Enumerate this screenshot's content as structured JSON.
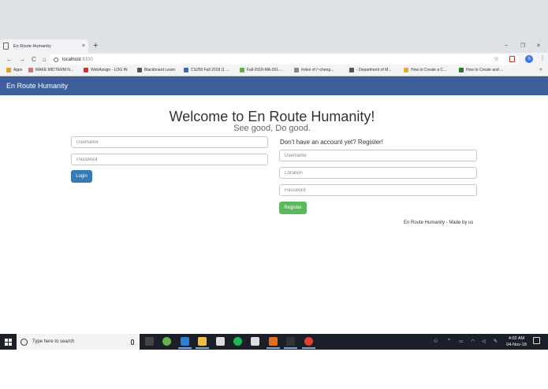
{
  "browser": {
    "tab": {
      "title": "En Route Humanity",
      "close": "×"
    },
    "new_tab": "+",
    "window": {
      "minimize": "–",
      "maximize": "❐",
      "close": "✕"
    },
    "nav": {
      "back": "←",
      "forward": "→",
      "reload": "C",
      "home": "⌂"
    },
    "url": {
      "host": "localhost",
      "port": ":8100"
    },
    "star": "☆",
    "profile_initial": "S",
    "menu": "⋮",
    "bookmarks": [
      {
        "label": "Apps",
        "color": "#e0a020"
      },
      {
        "label": "MAKE MIDTERM N...",
        "color": "#c77"
      },
      {
        "label": "WebAssign - LOG IN",
        "color": "#c33"
      },
      {
        "label": "Blackboard Learn",
        "color": "#555"
      },
      {
        "label": "CS250 Fall 2018 (1 ...",
        "color": "#3a6cb5"
      },
      {
        "label": "Fall-2018-MA-261-...",
        "color": "#6a4"
      },
      {
        "label": "Index of /~cheng...",
        "color": "#888"
      },
      {
        "label": "- Department of M...",
        "color": "#555"
      },
      {
        "label": "How to Create a C...",
        "color": "#e0b030"
      },
      {
        "label": "How to Create and ...",
        "color": "#2a7a2a"
      }
    ],
    "bookmarks_more": "»"
  },
  "app": {
    "brand": "En Route Humanity",
    "heading": "Welcome to En Route Humanity!",
    "subheading": "See good, Do good.",
    "login": {
      "username_placeholder": "Username",
      "password_placeholder": "Password",
      "button": "Login"
    },
    "register": {
      "heading": "Don't have an account yet? Register!",
      "username_placeholder": "Username",
      "location_placeholder": "Location",
      "password_placeholder": "Password",
      "button": "Register"
    },
    "footer": "En Route Humanity - Made by us"
  },
  "taskbar": {
    "search_placeholder": "Type here to search",
    "time": "4:02 AM",
    "date": "04-Nov-18",
    "apps": [
      {
        "name": "task-view",
        "color": "#444"
      },
      {
        "name": "android-studio",
        "color": "#6ab04c"
      },
      {
        "name": "edge",
        "color": "#2d7dd2"
      },
      {
        "name": "file-explorer",
        "color": "#f0c040"
      },
      {
        "name": "store",
        "color": "#ddd"
      },
      {
        "name": "spotify",
        "color": "#1db954"
      },
      {
        "name": "mail",
        "color": "#ddd"
      },
      {
        "name": "app-orange",
        "color": "#e07020"
      },
      {
        "name": "terminal",
        "color": "#333"
      },
      {
        "name": "chrome",
        "color": "#e04030"
      }
    ]
  },
  "colors": {
    "navbar": "#3e5f9c",
    "login_button": "#337ab7",
    "register_button": "#5cb85c"
  }
}
